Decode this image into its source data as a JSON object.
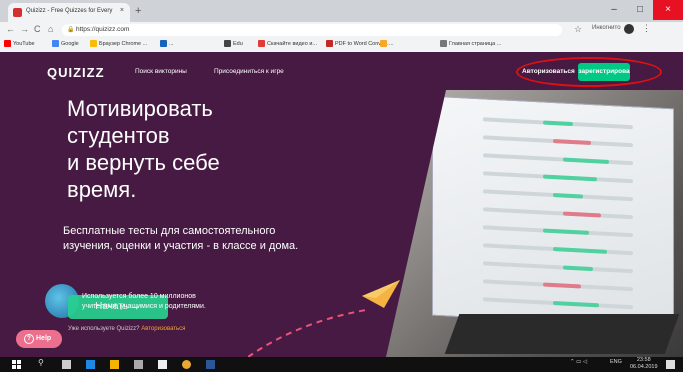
{
  "browser": {
    "tab_title": "Quizizz - Free Quizzes for Every",
    "tab_close": "×",
    "new_tab": "+",
    "url": "https://quizizz.com",
    "incognito_label": "Инкогнито",
    "window_minimize": "–",
    "window_maximize": "□",
    "window_close": "×",
    "bookmarks": [
      {
        "label": "YouTube",
        "color": "#ff0000"
      },
      {
        "label": "Google",
        "color": "#4285f4"
      },
      {
        "label": "Браузер Chrome ...",
        "color": "#fbbc05"
      },
      {
        "label": "...",
        "color": "#1565c0"
      },
      {
        "label": "Edu",
        "color": "#444444"
      },
      {
        "label": "Скачайте видео и...",
        "color": "#e53935"
      },
      {
        "label": "PDF to Word Conve...",
        "color": "#c62828"
      },
      {
        "label": "...",
        "color": "#f9a825"
      },
      {
        "label": "Главная страница ...",
        "color": "#777777"
      }
    ]
  },
  "site": {
    "logo": "QUIZIZZ",
    "nav": {
      "search_quizzes": "Поиск викторины",
      "join_game": "Присоединиться к игре",
      "login": "Авторизоваться",
      "signup": "зарегистрирова"
    },
    "headline": [
      "Мотивировать",
      "студентов",
      "и вернуть себе",
      "время."
    ],
    "subheadline": "Бесплатные тесты для самостоятельного изучения, оценки и участия - в классе и дома.",
    "stats_line1": "Используется более 10 миллионов",
    "stats_line2": "учителями, учащимися и родителями.",
    "start_button": "Начать →",
    "already_using": "Уже используете Quizizz?",
    "already_login": "Авторизоваться",
    "help": "Help",
    "colors": {
      "background": "#461a42",
      "accent": "#00c985",
      "annotation": "#dd1111"
    }
  },
  "taskbar": {
    "lang": "ENG",
    "time": "23:58",
    "date": "06.04.2019"
  }
}
